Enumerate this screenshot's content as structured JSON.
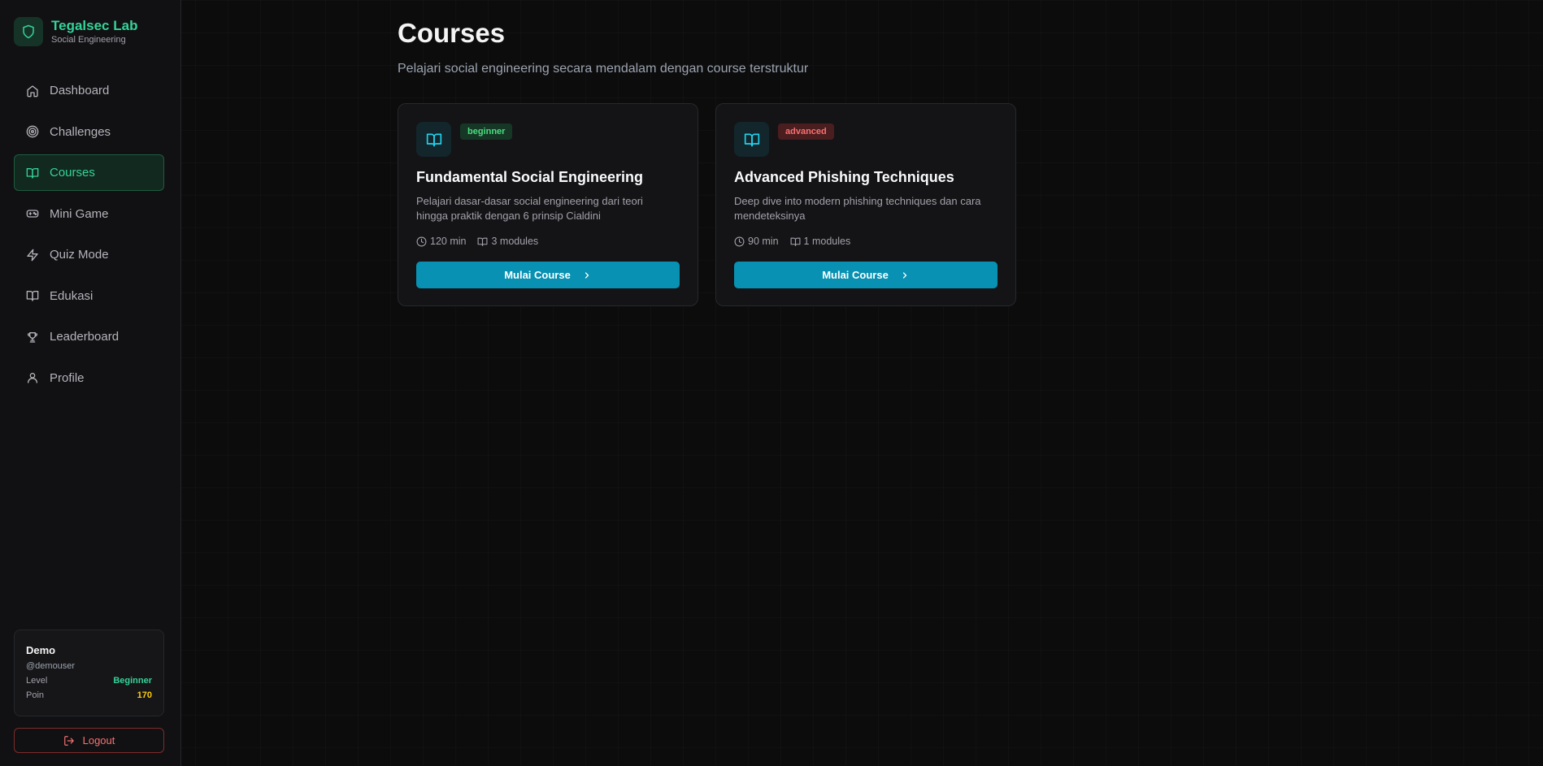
{
  "brand": {
    "title": "Tegalsec Lab",
    "subtitle": "Social Engineering"
  },
  "nav": [
    {
      "label": "Dashboard",
      "icon": "home-icon",
      "active": false
    },
    {
      "label": "Challenges",
      "icon": "target-icon",
      "active": false
    },
    {
      "label": "Courses",
      "icon": "book-open-icon",
      "active": true
    },
    {
      "label": "Mini Game",
      "icon": "gamepad-icon",
      "active": false
    },
    {
      "label": "Quiz Mode",
      "icon": "zap-icon",
      "active": false
    },
    {
      "label": "Edukasi",
      "icon": "book-icon",
      "active": false
    },
    {
      "label": "Leaderboard",
      "icon": "trophy-icon",
      "active": false
    },
    {
      "label": "Profile",
      "icon": "user-icon",
      "active": false
    }
  ],
  "user": {
    "name": "Demo",
    "handle": "@demouser",
    "level_label": "Level",
    "level_value": "Beginner",
    "points_label": "Poin",
    "points_value": "170"
  },
  "logout_label": "Logout",
  "page": {
    "title": "Courses",
    "subtitle": "Pelajari social engineering secara mendalam dengan course terstruktur"
  },
  "courses": [
    {
      "badge": "beginner",
      "title": "Fundamental Social Engineering",
      "description": "Pelajari dasar-dasar social engineering dari teori hingga praktik dengan 6 prinsip Cialdini",
      "duration": "120 min",
      "modules": "3 modules",
      "button": "Mulai Course"
    },
    {
      "badge": "advanced",
      "title": "Advanced Phishing Techniques",
      "description": "Deep dive into modern phishing techniques dan cara mendeteksinya",
      "duration": "90 min",
      "modules": "1 modules",
      "button": "Mulai Course"
    }
  ],
  "colors": {
    "accent_green": "#34d399",
    "primary_button": "#0891b2",
    "beginner_badge": "#4ade80",
    "advanced_badge": "#f87171",
    "points": "#facc15"
  }
}
